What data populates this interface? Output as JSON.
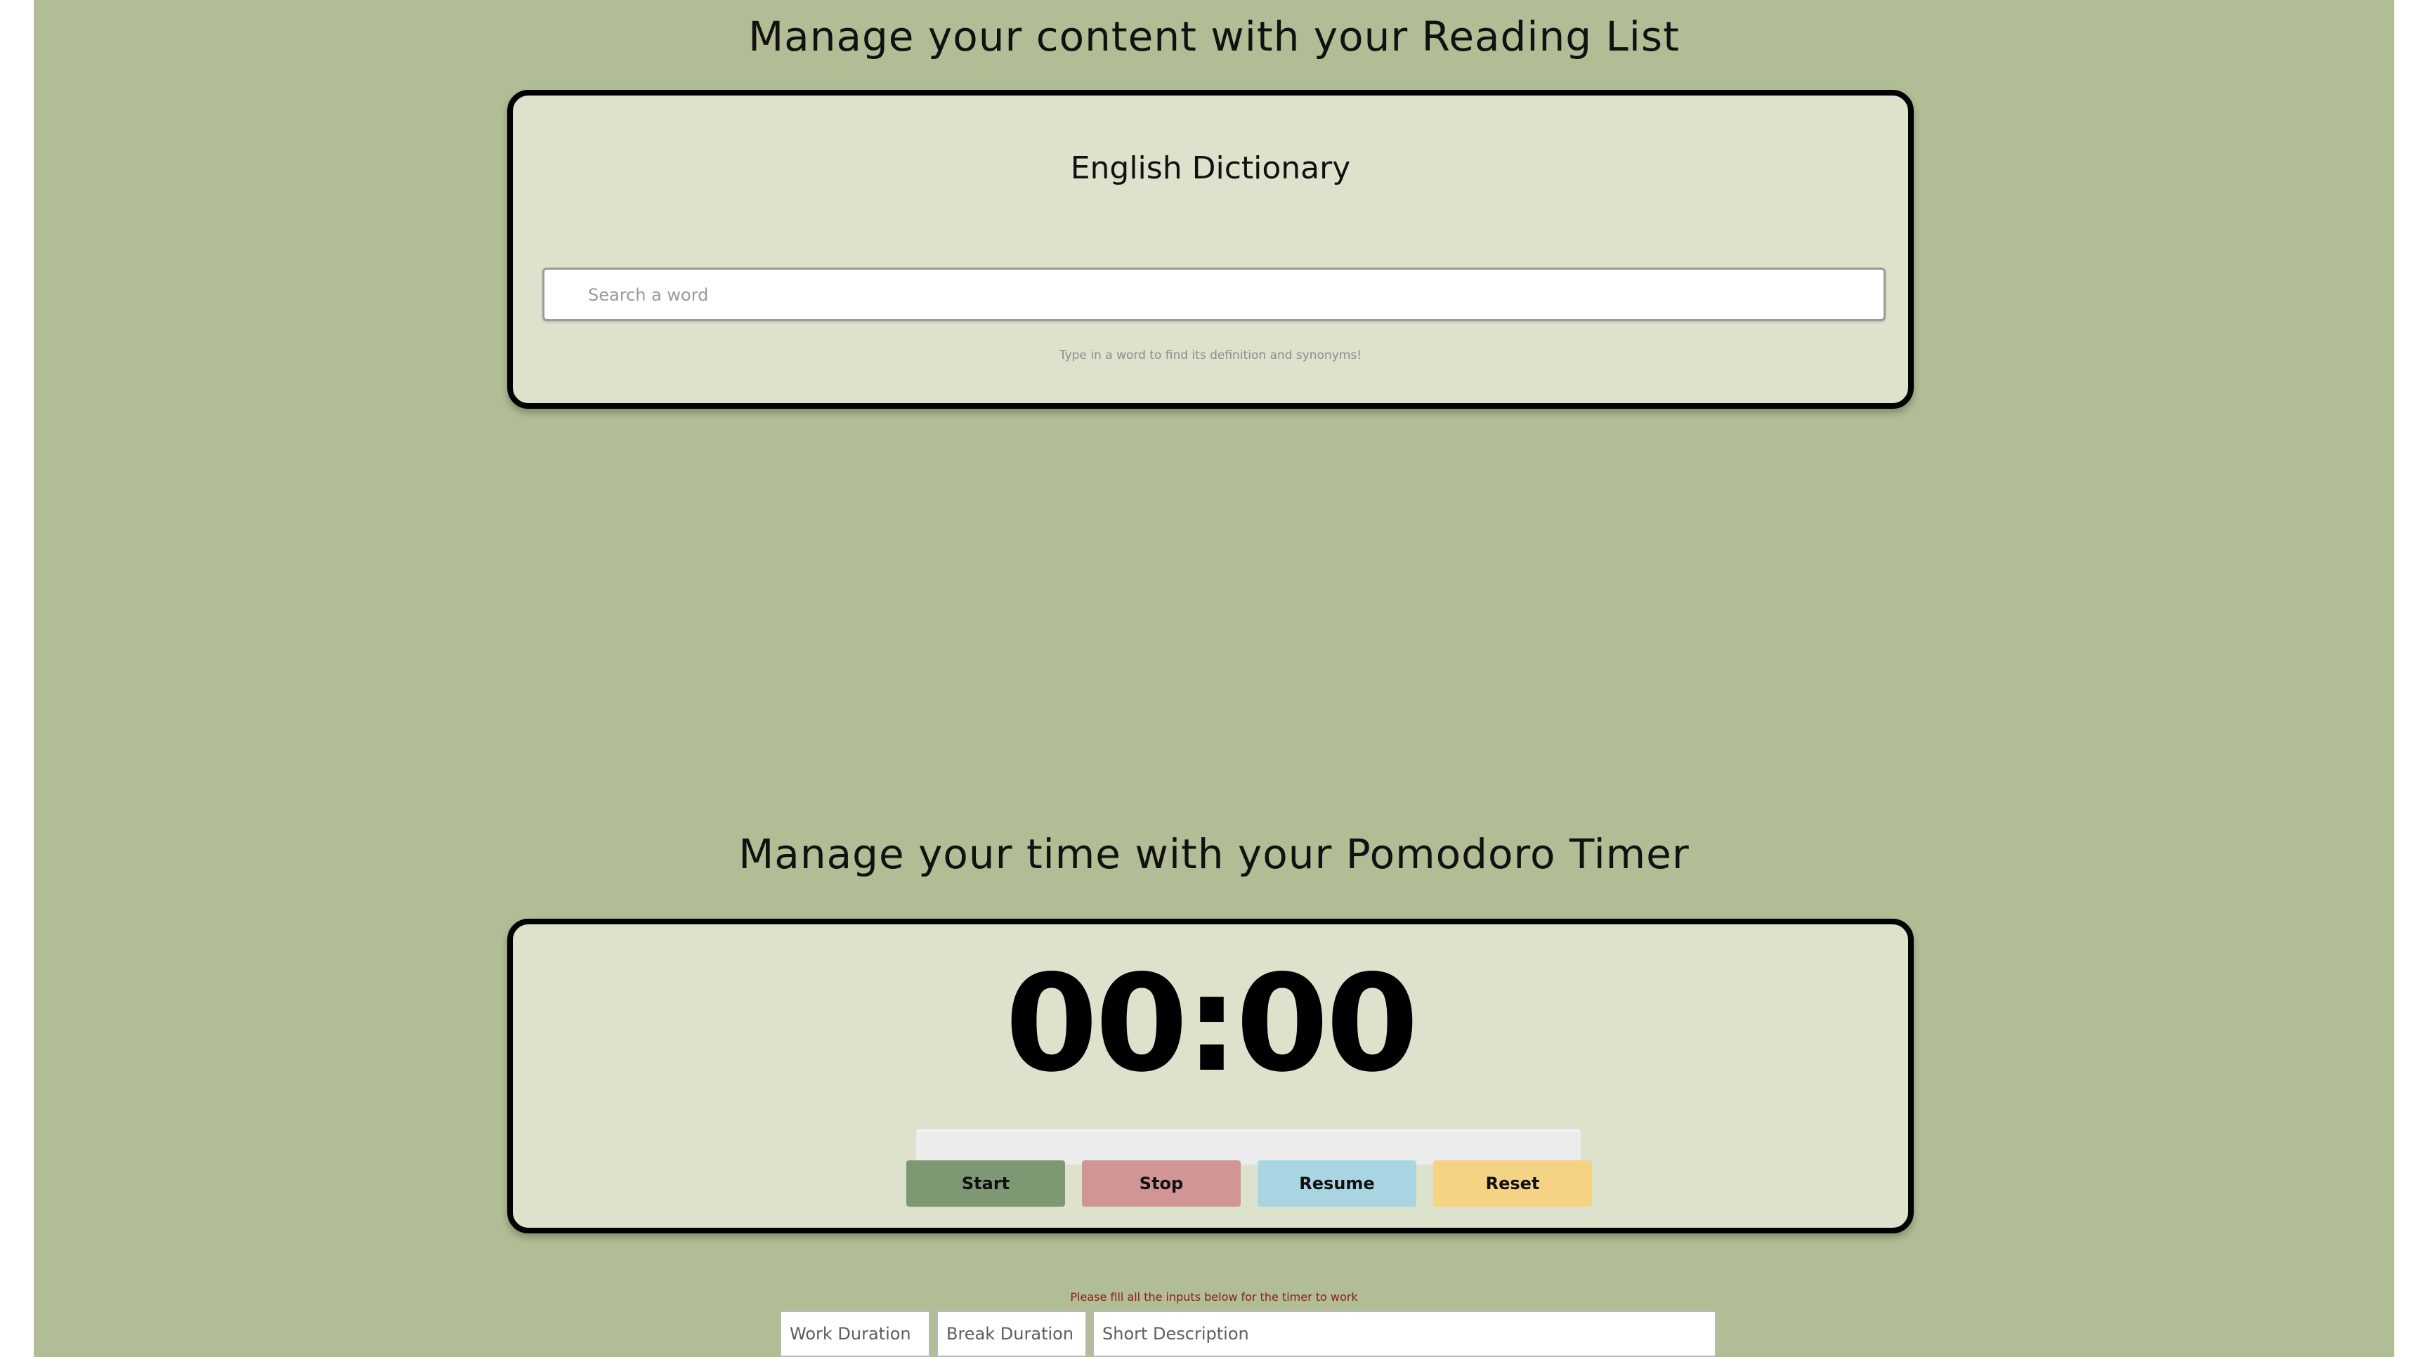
{
  "colors": {
    "background": "#b1bd95",
    "card": "#dce2cb",
    "start": "#7f9874",
    "stop": "#d19596",
    "resume": "#a9d5e2",
    "reset": "#f4d384"
  },
  "reading_list": {
    "title": "Manage your content with your Reading List",
    "dictionary": {
      "title": "English Dictionary",
      "search_placeholder": "Search a word",
      "search_value": "",
      "hint": "Type in a word to find its definition and synonyms!"
    }
  },
  "pomodoro": {
    "title": "Manage your time with your Pomodoro Timer",
    "time": "00:00",
    "progress": 0,
    "buttons": {
      "start": "Start",
      "stop": "Stop",
      "resume": "Resume",
      "reset": "Reset"
    },
    "notice": "Please fill all the inputs below for the timer to work",
    "inputs": {
      "work_placeholder": "Work Duration",
      "break_placeholder": "Break Duration",
      "description_placeholder": "Short Description"
    }
  }
}
